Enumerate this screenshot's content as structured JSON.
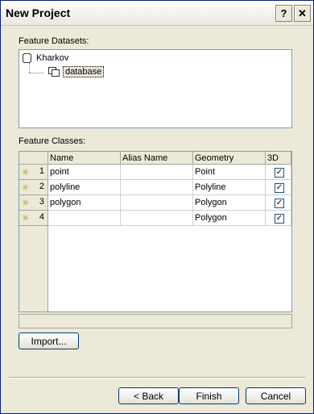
{
  "window": {
    "title": "New Project",
    "help_label": "?",
    "close_label": "✕"
  },
  "datasets": {
    "label": "Feature Datasets:",
    "root_label": "Kharkov",
    "child_label": "database"
  },
  "classes": {
    "label": "Feature Classes:",
    "columns": [
      "Name",
      "Alias Name",
      "Geometry",
      "3D"
    ],
    "rows": [
      {
        "num": "1",
        "name": "point",
        "alias": "",
        "geometry": "Point",
        "three_d": true
      },
      {
        "num": "2",
        "name": "polyline",
        "alias": "",
        "geometry": "Polyline",
        "three_d": true
      },
      {
        "num": "3",
        "name": "polygon",
        "alias": "",
        "geometry": "Polygon",
        "three_d": true
      },
      {
        "num": "4",
        "name": "",
        "alias": "",
        "geometry": "Polygon",
        "three_d": true
      }
    ]
  },
  "buttons": {
    "import": "Import...",
    "back": "< Back",
    "finish": "Finish",
    "cancel": "Cancel"
  }
}
